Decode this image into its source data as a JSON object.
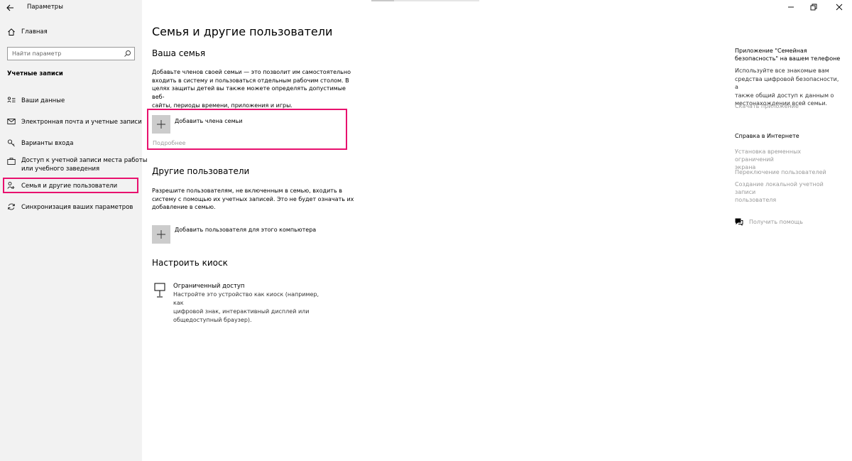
{
  "window": {
    "app_title": "Параметры"
  },
  "sidebar": {
    "home_label": "Главная",
    "search_placeholder": "Найти параметр",
    "section_title": "Учетные записи",
    "items": [
      {
        "label": "Ваши данные",
        "icon": "user-card-icon"
      },
      {
        "label": "Электронная почта и учетные записи",
        "icon": "mail-icon"
      },
      {
        "label": "Варианты входа",
        "icon": "key-icon"
      },
      {
        "label_line1": "Доступ к учетной записи места работы",
        "label_line2": "или учебного заведения",
        "icon": "briefcase-icon"
      },
      {
        "label": "Семья и другие пользователи",
        "icon": "family-icon",
        "selected": true
      },
      {
        "label": "Синхронизация ваших параметров",
        "icon": "sync-icon"
      }
    ]
  },
  "main": {
    "page_title": "Семья и другие пользователи",
    "family": {
      "heading": "Ваша семья",
      "desc_lines": [
        "Добавьте членов своей семьи — это позволит им самостоятельно",
        "входить в систему и пользоваться отдельным рабочим столом. В",
        "целях защиты детей вы также можете определять допустимые веб-",
        "сайты, периоды времени, приложения и игры."
      ],
      "add_label": "Добавить члена семьи",
      "more_link": "Подробнее"
    },
    "others": {
      "heading": "Другие пользователи",
      "desc_lines": [
        "Разрешите пользователям, не включенным в семью, входить в",
        "систему с помощью их учетных записей. Это не будет означать их",
        "добавление в семью."
      ],
      "add_label": "Добавить пользователя для этого компьютера"
    },
    "kiosk": {
      "heading": "Настроить киоск",
      "title": "Ограниченный доступ",
      "desc_lines": [
        "Настройте это устройство как киоск (например, как",
        "цифровой знак, интерактивный дисплей или",
        "общедоступный браузер)."
      ]
    }
  },
  "right": {
    "app_title_lines": [
      "Приложение \"Семейная",
      "безопасность\" на вашем телефоне"
    ],
    "app_desc_lines": [
      "Используйте все знакомые вам",
      "средства цифровой безопасности, а",
      "также общий доступ к данным о",
      "местонахождении всей семьи."
    ],
    "download_link": "Скачать приложение",
    "help_title": "Справка в Интернете",
    "help_links": [
      {
        "line1": "Установка временных ограничений",
        "line2": "экрана"
      },
      {
        "line1": "Переключение пользователей",
        "line2": ""
      },
      {
        "line1": "Создание локальной учетной записи",
        "line2": "пользователя"
      }
    ],
    "get_help": "Получить помощь"
  },
  "colors": {
    "highlight": "#e8116e",
    "sidebar_bg": "#f2f2f2",
    "plus_box": "#cccccc",
    "muted_link": "#9a9a9a"
  }
}
